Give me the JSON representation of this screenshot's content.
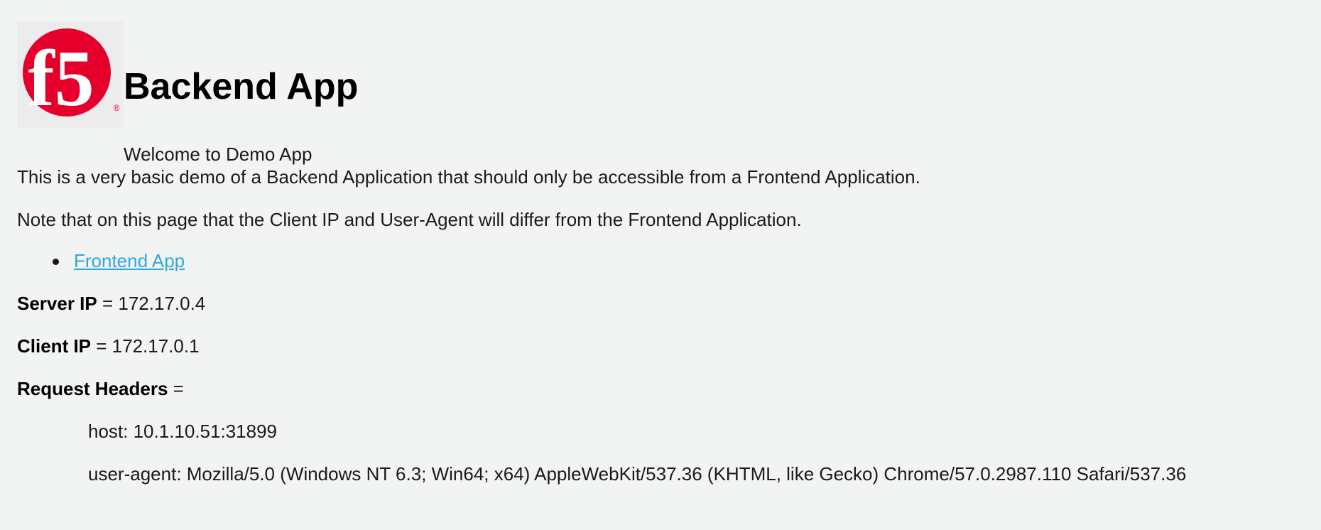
{
  "header": {
    "title": "Backend App",
    "subtitle": "Welcome to Demo App"
  },
  "logo": {
    "brand_color": "#e4002b",
    "text": "f5",
    "registered_mark": "®"
  },
  "intro": {
    "line1": "This is a very basic demo of a Backend Application that should only be accessible from a Frontend Application.",
    "line2": "Note that on this page that the Client IP and User-Agent will differ from the Frontend Application."
  },
  "links": [
    {
      "label": "Frontend App"
    }
  ],
  "info": {
    "server_ip_label": "Server IP",
    "server_ip_value": " = 172.17.0.4",
    "client_ip_label": "Client IP",
    "client_ip_value": " = 172.17.0.1",
    "headers_label": "Request Headers",
    "headers_eq": " ="
  },
  "request_headers": [
    "host: 10.1.10.51:31899",
    "user-agent: Mozilla/5.0 (Windows NT 6.3; Win64; x64) AppleWebKit/537.36 (KHTML, like Gecko) Chrome/57.0.2987.110 Safari/537.36"
  ],
  "colors": {
    "background": "#f2f3f3",
    "link": "#2ea7e6"
  }
}
